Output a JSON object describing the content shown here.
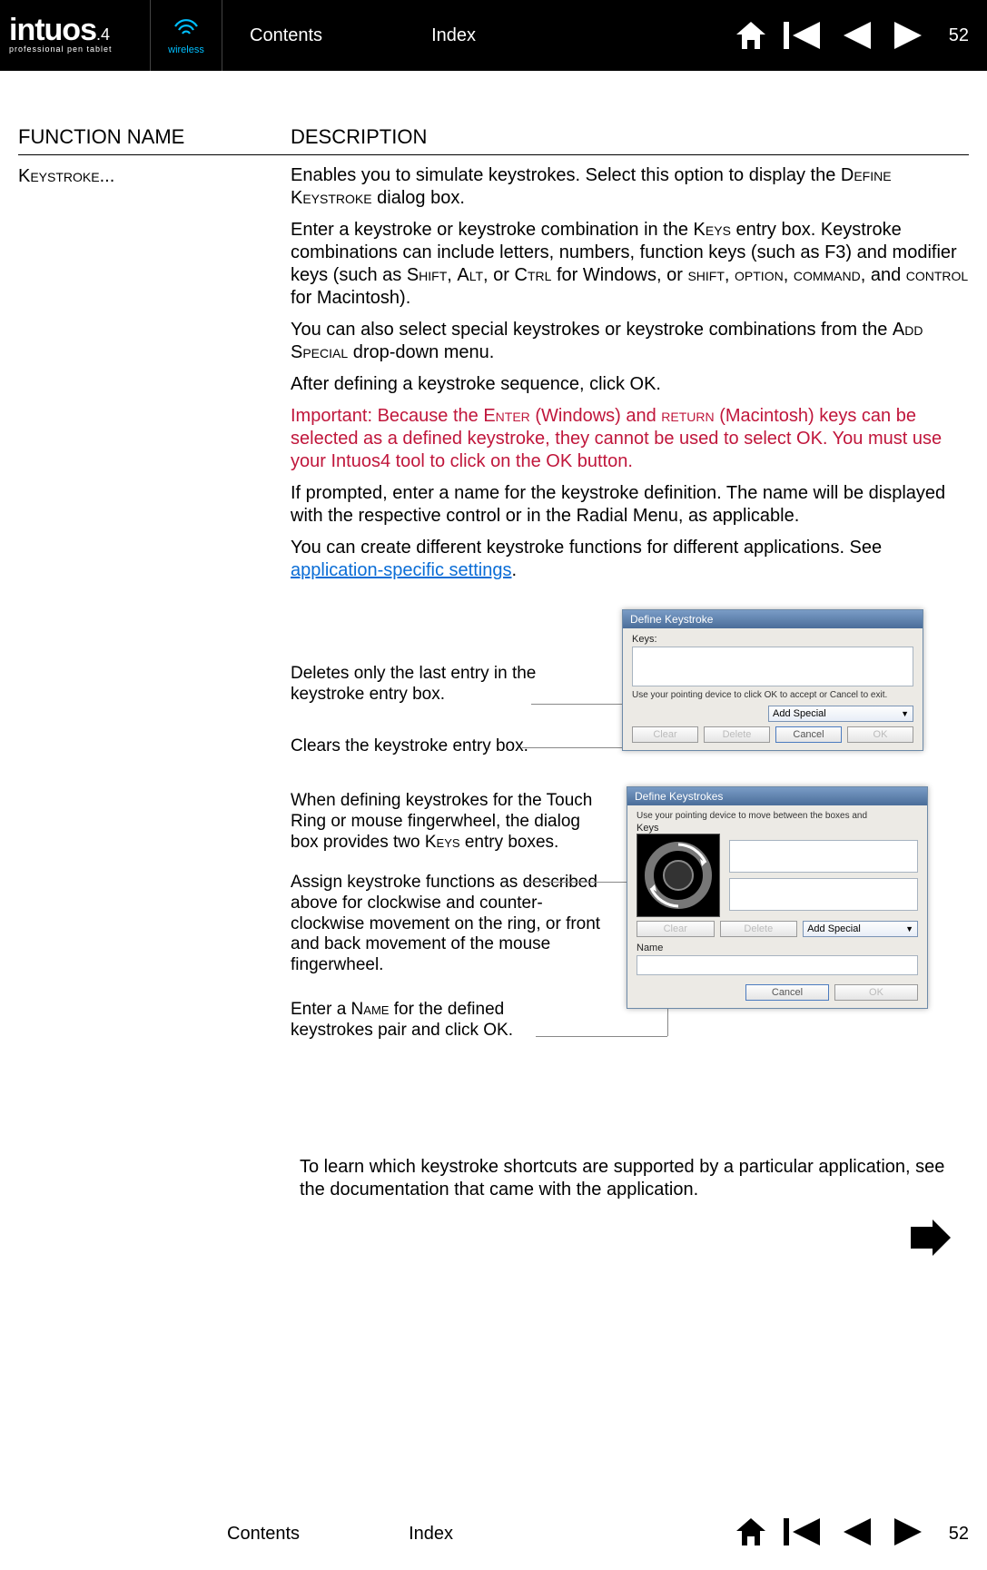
{
  "page_number": "52",
  "logo": {
    "main": "intuos",
    "four": "4",
    "sub": "professional pen tablet"
  },
  "wireless_label": "wireless",
  "nav": {
    "contents": "Contents",
    "index": "Index"
  },
  "columns": {
    "func": "FUNCTION NAME",
    "desc": "DESCRIPTION"
  },
  "function_name": "Keystroke...",
  "p1a": "Enables you to simulate keystrokes.  Select this option to display the ",
  "p1b": "Define Keystroke",
  "p1c": " dialog box.",
  "p2a": "Enter a keystroke or keystroke combination in the ",
  "p2b": "Keys",
  "p2c": " entry box. Keystroke combinations can include letters, numbers, function keys (such as F3) and modifier keys (such as ",
  "p2d": "Shift",
  "p2e": ", ",
  "p2f": "Alt",
  "p2g": ", or ",
  "p2h": "Ctrl",
  "p2i": " for Windows, or ",
  "p2j": "shift",
  "p2k": ", ",
  "p2l": "option",
  "p2m": ", ",
  "p2n": "command",
  "p2o": ", and ",
  "p2p": "control",
  "p2q": " for Macintosh).",
  "p3a": "You can also select special keystrokes or keystroke combinations from the ",
  "p3b": "Add Special",
  "p3c": " drop-down menu.",
  "p4": "After defining a keystroke sequence, click OK.",
  "p5a": "Important: Because the ",
  "p5b": "Enter",
  "p5c": " (Windows) and ",
  "p5d": "return",
  "p5e": " (Macintosh) keys can be selected as a defined keystroke, they cannot be used to select OK.  You must use your Intuos4 tool to click on the OK button.",
  "p6": "If prompted, enter a name for the keystroke definition.  The name will be displayed with the respective control or in the Radial Menu, as applicable.",
  "p7a": "You can create different keystroke functions for different applications. See ",
  "p7b": "application-specific settings",
  "p7c": ".",
  "callouts": {
    "c1": "Deletes only the last entry in the keystroke entry box.",
    "c2": "Clears the keystroke entry box.",
    "c3a": "When defining keystrokes for the Touch Ring or mouse fingerwheel, the dialog box provides two ",
    "c3b": "Keys",
    "c3c": " entry boxes.",
    "c4": "Assign keystroke functions as described above for clockwise and counter-clockwise movement on the ring, or front and back movement of the mouse fingerwheel.",
    "c5a": "Enter a ",
    "c5b": "Name",
    "c5c": " for the defined keystrokes pair and click OK."
  },
  "dlg1": {
    "title": "Define Keystroke",
    "keys_label": "Keys:",
    "hint": "Use your pointing device to click OK to accept or Cancel to exit.",
    "add_special": "Add Special",
    "clear": "Clear",
    "delete": "Delete",
    "cancel": "Cancel",
    "ok": "OK"
  },
  "dlg2": {
    "title": "Define Keystrokes",
    "hint": "Use your pointing device to move between the boxes and",
    "keys_label": "Keys",
    "clear": "Clear",
    "delete": "Delete",
    "add_special": "Add Special",
    "name_label": "Name",
    "cancel": "Cancel",
    "ok": "OK"
  },
  "closing": "To learn which keystroke shortcuts are supported by a particular application, see the documentation that came with the application."
}
